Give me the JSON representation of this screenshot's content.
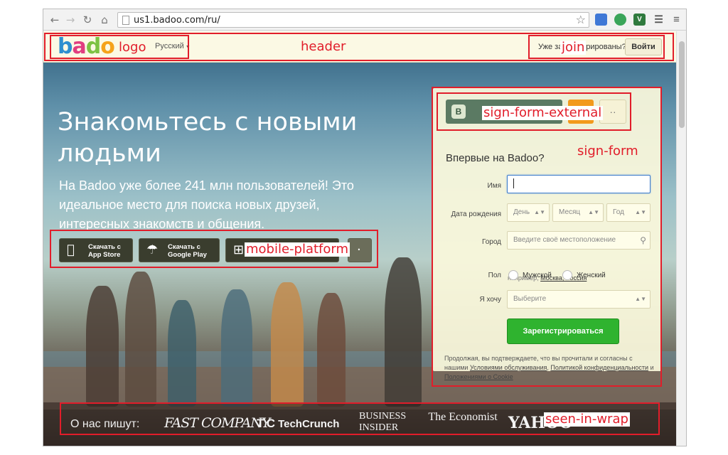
{
  "browser": {
    "url": "us1.badoo.com/ru/",
    "back_icon": "←",
    "forward_icon": "→",
    "reload_icon": "↻",
    "home_icon": "⌂",
    "star_icon": "☆",
    "menu_icon": "≡",
    "ext_v": "V"
  },
  "header": {
    "logo": {
      "b": "b",
      "a": "a",
      "d": "d",
      "o": "o"
    },
    "language": "Русский",
    "join_text": "Уже зарегистрированы?",
    "login_label": "Войти"
  },
  "hero": {
    "headline": "Знакомьтесь с новыми людьми",
    "subline": "На Badoo уже более 241 млн пользователей! Это идеальное место для поиска новых друзей, интересных знакомств и общения."
  },
  "mobile": {
    "appstore_label": "Скачать с App Store",
    "googleplay_label": "Скачать с Google Play",
    "apple_icon": "",
    "android_icon": "☂",
    "windows_icon": "⊞",
    "more_icon": "·"
  },
  "signform": {
    "vk_icon": "B",
    "ok_icon": "⚬",
    "more_icon": "··",
    "title": "Впервые на Badoo?",
    "name_label": "Имя",
    "dob_label": "Дата рождения",
    "day_placeholder": "День",
    "month_placeholder": "Месяц",
    "year_placeholder": "Год",
    "city_label": "Город",
    "city_placeholder": "Введите своё местоположение",
    "hint_prefix": "например,",
    "hint_link": "Москва, Россия",
    "gender_label": "Пол",
    "male_label": "Мужской",
    "female_label": "Женский",
    "want_label": "Я хочу",
    "want_placeholder": "Выберите",
    "register_label": "Зарегистрироваться",
    "legal_text": "Продолжая, вы подтверждаете, что вы прочитали и согласны с нашими",
    "legal_terms": "Условиями обслуживания",
    "legal_privacy": "Политикой конфиденциальности",
    "legal_and": "и",
    "legal_cookies": "Положениями о Cookie"
  },
  "seenin": {
    "title": "О нас пишут:",
    "press": [
      "FAST COMPANY",
      "TechCrunch",
      "BUSINESS INSIDER",
      "The Economist",
      "YAHOO"
    ]
  },
  "annotations": {
    "logo": "logo",
    "header": "header",
    "join": "join",
    "sign_form_external": "sign-form-external",
    "sign_form": "sign-form",
    "mobile_platform": "mobile-platform",
    "seen_in_wrap": "seen-in-wrap"
  },
  "colors": {
    "annotation": "#e11d2a",
    "register_green": "#2fb32f",
    "vk_green": "#5b7a63",
    "ok_orange": "#f29a1c"
  }
}
